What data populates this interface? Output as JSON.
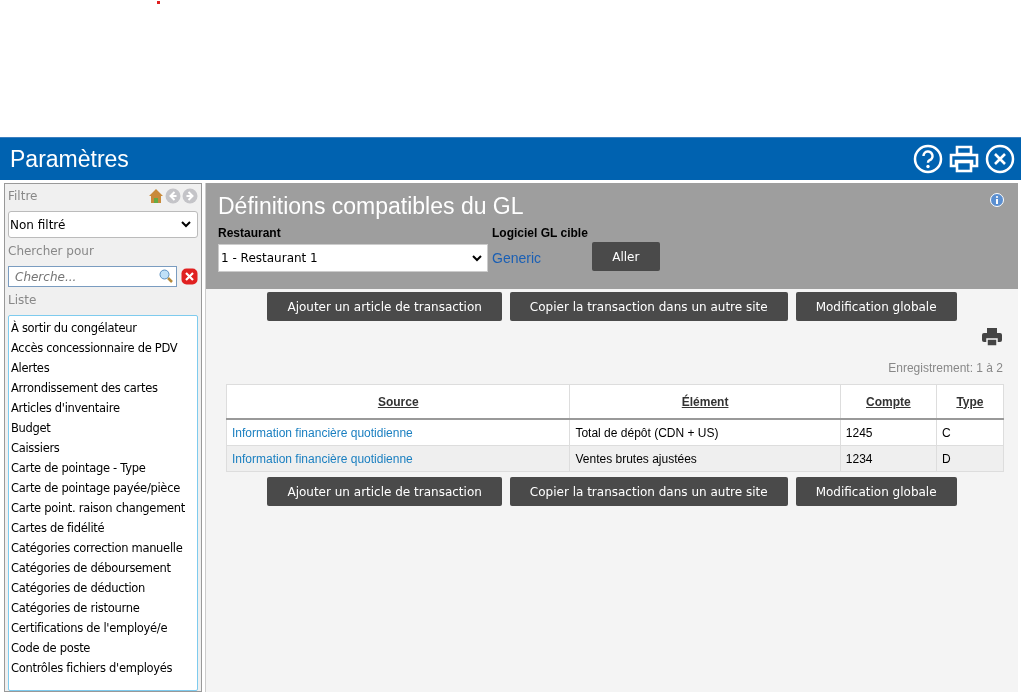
{
  "window": {
    "title": "Paramètres"
  },
  "sidebar": {
    "filter_label": "Filtre",
    "filter_value": "Non filtré",
    "search_label": "Chercher pour",
    "search_placeholder": "Cherche...",
    "list_label": "Liste",
    "items": [
      "À sortir du congélateur",
      "Accès concessionnaire de PDV",
      "Alertes",
      "Arrondissement des cartes",
      "Articles d'inventaire",
      "Budget",
      "Caissiers",
      "Carte de pointage - Type",
      "Carte de pointage payée/pièce",
      "Carte point. raison changement",
      "Cartes de fidélité",
      "Catégories correction manuelle",
      "Catégories de déboursement",
      "Catégories de déduction",
      "Catégories de ristourne",
      "Certifications de l'employé/e",
      "Code de poste",
      "Contrôles fichiers d'employés"
    ]
  },
  "panel": {
    "title": "Définitions compatibles du GL",
    "restaurant_label": "Restaurant",
    "restaurant_value": "1 - Restaurant 1",
    "gl_label": "Logiciel GL cible",
    "gl_value": "Generic",
    "go_button": "Aller"
  },
  "actions_top": [
    "Ajouter un article de transaction",
    "Copier la transaction dans un autre site",
    "Modification globale"
  ],
  "record_count": "Enregistrement: 1 à 2",
  "table": {
    "columns": [
      "Source",
      "Élément",
      "Compte",
      "Type"
    ],
    "rows": [
      [
        "Information financière quotidienne",
        "Total de dépôt (CDN + US)",
        "1245",
        "C"
      ],
      [
        "Information financière quotidienne",
        "Ventes brutes ajustées",
        "1234",
        "D"
      ]
    ]
  },
  "actions_bottom": [
    "Ajouter un article de transaction",
    "Copier la transaction dans un autre site",
    "Modification globale"
  ]
}
